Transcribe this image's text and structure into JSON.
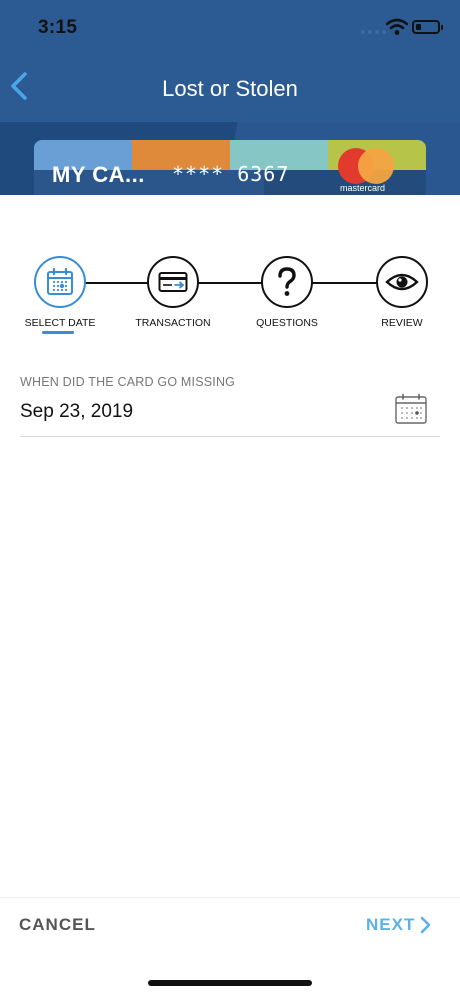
{
  "status_bar": {
    "time": "3:15"
  },
  "nav": {
    "title": "Lost or Stolen"
  },
  "card": {
    "name": "MY CA...",
    "number": "**** 6367",
    "brand": "mastercard"
  },
  "stepper": {
    "steps": [
      {
        "label": "SELECT DATE",
        "icon": "calendar-icon",
        "active": true
      },
      {
        "label": "TRANSACTION",
        "icon": "card-icon",
        "active": false
      },
      {
        "label": "QUESTIONS",
        "icon": "question-icon",
        "active": false
      },
      {
        "label": "REVIEW",
        "icon": "eye-icon",
        "active": false
      }
    ]
  },
  "form": {
    "date_label": "WHEN DID THE CARD GO MISSING",
    "date_value": "Sep 23, 2019"
  },
  "footer": {
    "cancel_label": "CANCEL",
    "next_label": "NEXT"
  },
  "colors": {
    "header": "#2c5b94",
    "accent": "#3a8dd4",
    "next": "#59b3e6",
    "cancel": "#555555"
  }
}
